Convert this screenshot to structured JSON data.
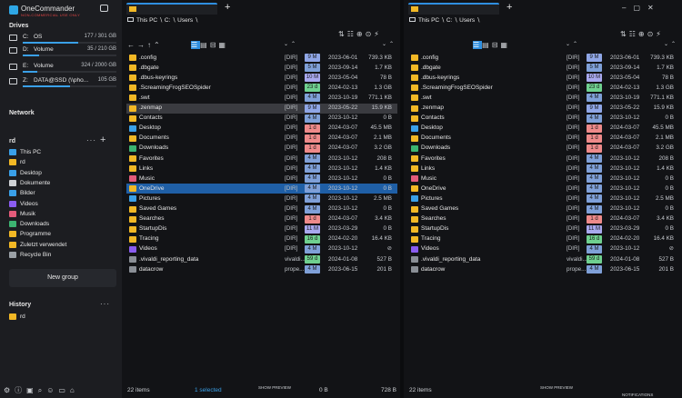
{
  "app": {
    "title": "OneCommander",
    "subtitle": "NON-COMMERCIAL USE ONLY"
  },
  "sidebar": {
    "drives_header": "Drives",
    "drives": [
      {
        "letter": "C:",
        "name": "OS",
        "size": "177 / 301 GB",
        "used": 0.59
      },
      {
        "letter": "D:",
        "name": "Volume",
        "size": "35 / 210 GB",
        "used": 0.17
      },
      {
        "letter": "E:",
        "name": "Volume",
        "size": "324 / 2000 GB",
        "used": 0.16
      },
      {
        "letter": "Z:",
        "name": "DATA@SSD (\\\\pho...",
        "size": "105 GB",
        "used": 0.5
      }
    ],
    "network_header": "Network",
    "favorites_header": "rd",
    "favorites": [
      {
        "label": "This PC",
        "icon": "pc-icon"
      },
      {
        "label": "rd",
        "icon": "folder-icon"
      },
      {
        "label": "Desktop",
        "icon": "desktop-icon"
      },
      {
        "label": "Dokumente",
        "icon": "documents-icon"
      },
      {
        "label": "Bilder",
        "icon": "pictures-icon"
      },
      {
        "label": "Videos",
        "icon": "videos-icon"
      },
      {
        "label": "Musik",
        "icon": "music-icon"
      },
      {
        "label": "Downloads",
        "icon": "downloads-icon"
      },
      {
        "label": "Programme",
        "icon": "folder-icon"
      },
      {
        "label": "Zuletzt verwendet",
        "icon": "recent-icon"
      },
      {
        "label": "Recycle Bin",
        "icon": "recycle-bin-icon"
      }
    ],
    "new_group_label": "New group",
    "history_header": "History",
    "history_items": [
      {
        "label": "rd"
      }
    ]
  },
  "panes": [
    {
      "breadcrumb": [
        "This PC",
        "C:",
        "Users"
      ],
      "status_items": "22 items",
      "status_selected": "1 selected",
      "status_size_a": "0 B",
      "status_size_b": "728 B",
      "show_preview": "SHOW PREVIEW"
    },
    {
      "breadcrumb": [
        "This PC",
        "C:",
        "Users"
      ],
      "status_items": "22 items",
      "status_selected": "",
      "status_size_a": "",
      "status_size_b": "",
      "show_preview": "SHOW PREVIEW",
      "notifications": "NOTIFICATIONS"
    }
  ],
  "files": [
    {
      "name": ".config",
      "type": "[DIR]",
      "age": "9 M",
      "color": "#8fa6e6",
      "date": "2023-06-01",
      "size": "739.3 KB",
      "icon": "folder"
    },
    {
      "name": ".dbgate",
      "type": "[DIR]",
      "age": "5 M",
      "color": "#7fa0d8",
      "date": "2023-09-14",
      "size": "1.7 KB",
      "icon": "folder"
    },
    {
      "name": ".dbus-keyrings",
      "type": "[DIR]",
      "age": "10 M",
      "color": "#a8a8ee",
      "date": "2023-05-04",
      "size": "78 B",
      "icon": "folder"
    },
    {
      "name": ".ScreamingFrogSEOSpider",
      "type": "[DIR]",
      "age": "23 d",
      "color": "#6fd08f",
      "date": "2024-02-13",
      "size": "1.3 GB",
      "icon": "folder"
    },
    {
      "name": ".swt",
      "type": "[DIR]",
      "age": "4 M",
      "color": "#7fa0d8",
      "date": "2023-10-19",
      "size": "771.1 KB",
      "icon": "folder"
    },
    {
      "name": ".zenmap",
      "type": "[DIR]",
      "age": "9 M",
      "color": "#8fa6e6",
      "date": "2023-05-22",
      "size": "15.9 KB",
      "icon": "folder"
    },
    {
      "name": "Contacts",
      "type": "[DIR]",
      "age": "4 M",
      "color": "#7fa0d8",
      "date": "2023-10-12",
      "size": "0 B",
      "icon": "folder"
    },
    {
      "name": "Desktop",
      "type": "[DIR]",
      "age": "1 d",
      "color": "#ee8a8a",
      "date": "2024-03-07",
      "size": "45.5 MB",
      "icon": "blue"
    },
    {
      "name": "Documents",
      "type": "[DIR]",
      "age": "1 d",
      "color": "#ee8a8a",
      "date": "2024-03-07",
      "size": "2.1 MB",
      "icon": "folder"
    },
    {
      "name": "Downloads",
      "type": "[DIR]",
      "age": "1 d",
      "color": "#ee8a8a",
      "date": "2024-03-07",
      "size": "3.2 GB",
      "icon": "green"
    },
    {
      "name": "Favorites",
      "type": "[DIR]",
      "age": "4 M",
      "color": "#7fa0d8",
      "date": "2023-10-12",
      "size": "208 B",
      "icon": "folder"
    },
    {
      "name": "Links",
      "type": "[DIR]",
      "age": "4 M",
      "color": "#7fa0d8",
      "date": "2023-10-12",
      "size": "1.4 KB",
      "icon": "folder"
    },
    {
      "name": "Music",
      "type": "[DIR]",
      "age": "4 M",
      "color": "#7fa0d8",
      "date": "2023-10-12",
      "size": "0 B",
      "icon": "red"
    },
    {
      "name": "OneDrive",
      "type": "[DIR]",
      "age": "4 M",
      "color": "#7fa0d8",
      "date": "2023-10-12",
      "size": "0 B",
      "icon": "folder"
    },
    {
      "name": "Pictures",
      "type": "[DIR]",
      "age": "4 M",
      "color": "#7fa0d8",
      "date": "2023-10-12",
      "size": "2.5 MB",
      "icon": "blue"
    },
    {
      "name": "Saved Games",
      "type": "[DIR]",
      "age": "4 M",
      "color": "#7fa0d8",
      "date": "2023-10-12",
      "size": "0 B",
      "icon": "folder"
    },
    {
      "name": "Searches",
      "type": "[DIR]",
      "age": "1 d",
      "color": "#ee8a8a",
      "date": "2024-03-07",
      "size": "3.4 KB",
      "icon": "folder"
    },
    {
      "name": "StartupDis",
      "type": "[DIR]",
      "age": "11 M",
      "color": "#a8a8ee",
      "date": "2023-03-29",
      "size": "0 B",
      "icon": "folder"
    },
    {
      "name": "Tracing",
      "type": "[DIR]",
      "age": "16 d",
      "color": "#6fd08f",
      "date": "2024-02-20",
      "size": "16.4 KB",
      "icon": "folder"
    },
    {
      "name": "Videos",
      "type": "[DIR]",
      "age": "4 M",
      "color": "#7fa0d8",
      "date": "2023-10-12",
      "size": "⊘",
      "icon": "purple"
    },
    {
      "name": ".vivaldi_reporting_data",
      "type": "vivaldi...",
      "age": "59 d",
      "color": "#6fd08f",
      "date": "2024-01-08",
      "size": "527 B",
      "icon": "file"
    },
    {
      "name": "datacrow",
      "type": "prope...",
      "age": "4 M",
      "color": "#7fa0d8",
      "date": "2023-06-15",
      "size": "201 B",
      "icon": "file"
    }
  ],
  "pane1_selected_index": 13,
  "pane1_highlight_index": 5
}
